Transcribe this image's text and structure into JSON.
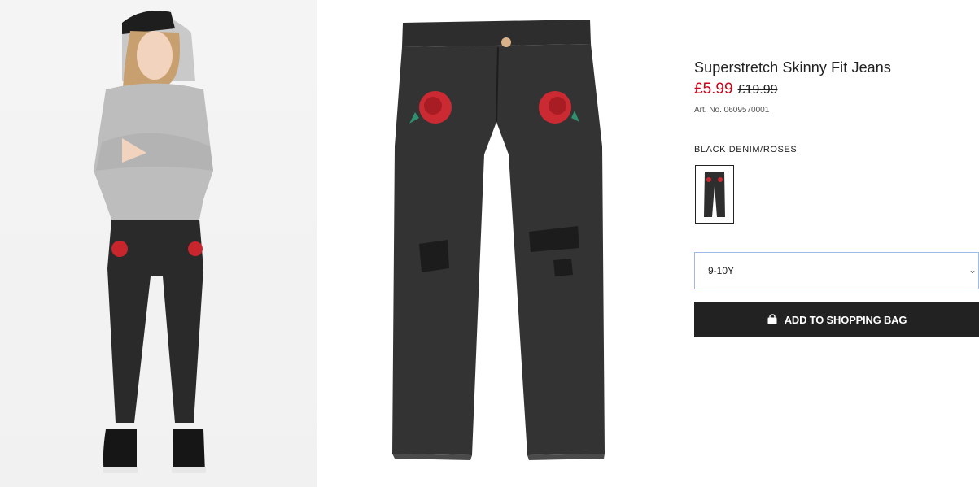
{
  "product": {
    "title": "Superstretch Skinny Fit Jeans",
    "price_sale": "£5.99",
    "price_original": "£19.99",
    "article_number": "Art. No. 0609570001",
    "color_name": "BLACK DENIM/ROSES"
  },
  "size_selector": {
    "selected": "9-10Y"
  },
  "actions": {
    "add_to_bag_label": "ADD TO SHOPPING BAG"
  },
  "colors": {
    "sale_price": "#d0021b",
    "button_bg": "#222222",
    "select_border": "#9ebbe6"
  },
  "icons": {
    "bag": "shopping-bag-icon",
    "dropdown": "chevron-down-icon"
  }
}
